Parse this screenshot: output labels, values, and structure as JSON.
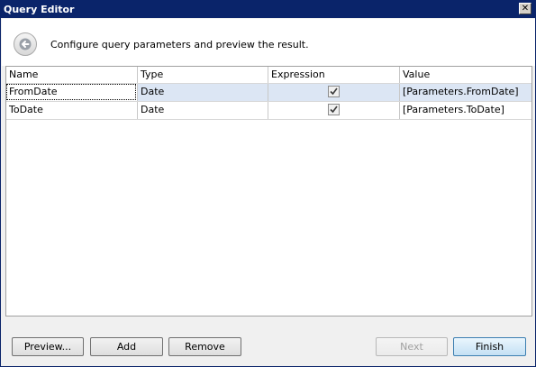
{
  "window": {
    "title": "Query Editor",
    "close_glyph": "✕"
  },
  "header": {
    "back_icon": "back-arrow-icon",
    "subtitle": "Configure query parameters and preview the result."
  },
  "grid": {
    "columns": [
      "Name",
      "Type",
      "Expression",
      "Value"
    ],
    "rows": [
      {
        "name": "FromDate",
        "type": "Date",
        "expression": true,
        "value": "[Parameters.FromDate]"
      },
      {
        "name": "ToDate",
        "type": "Date",
        "expression": true,
        "value": "[Parameters.ToDate]"
      }
    ]
  },
  "buttons": {
    "preview": "Preview...",
    "add": "Add",
    "remove": "Remove",
    "next": "Next",
    "finish": "Finish"
  },
  "colors": {
    "titlebar": "#0a246a",
    "selected_row": "#dce6f4"
  }
}
